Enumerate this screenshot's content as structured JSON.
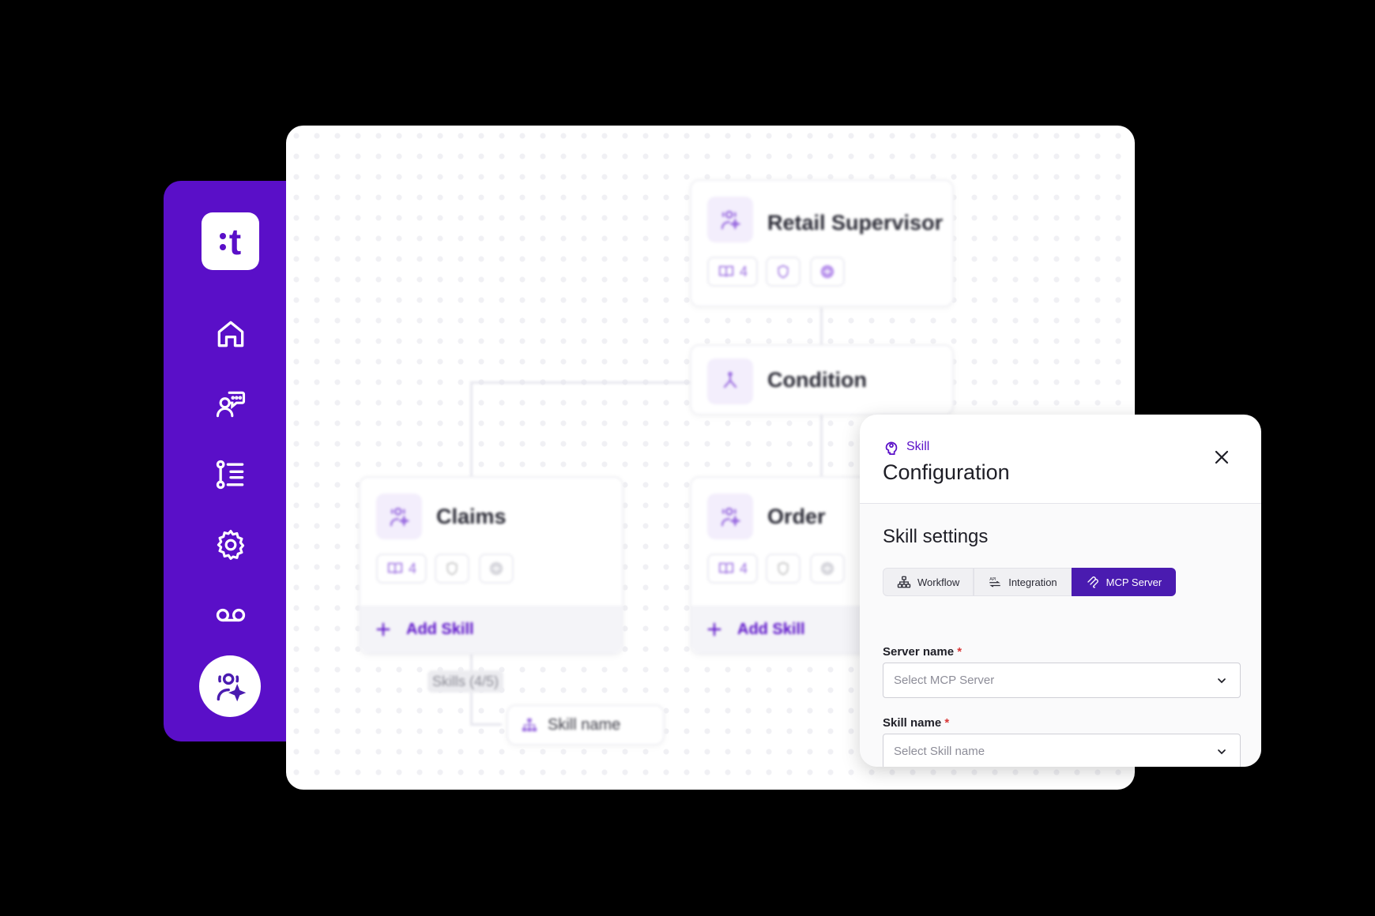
{
  "sidebar": {
    "logo_text": "t",
    "nav": [
      {
        "icon": "home-icon"
      },
      {
        "icon": "agent-chat-icon"
      },
      {
        "icon": "ordered-list-icon"
      },
      {
        "icon": "gear-icon"
      },
      {
        "icon": "voicemail-icon"
      },
      {
        "icon": "agent-sparkle-icon",
        "active": true
      }
    ]
  },
  "canvas": {
    "supervisor": {
      "title": "Retail Supervisor",
      "knowledge_count": "4"
    },
    "condition": {
      "title": "Condition"
    },
    "claims": {
      "title": "Claims",
      "knowledge_count": "4",
      "add_skill": "Add Skill"
    },
    "order": {
      "title": "Order",
      "knowledge_count": "4",
      "add_skill": "Add Skill"
    },
    "skills_badge": "Skills (4/5)",
    "skill_item": "Skill name"
  },
  "panel": {
    "eyebrow": "Skill",
    "title": "Configuration",
    "section_title": "Skill settings",
    "tabs": [
      {
        "label": "Workflow",
        "icon": "workflow-icon"
      },
      {
        "label": "Integration",
        "icon": "api-icon"
      },
      {
        "label": "MCP Server",
        "icon": "mcp-icon",
        "active": true
      }
    ],
    "server_name": {
      "label": "Server name",
      "required": "*",
      "placeholder": "Select MCP Server"
    },
    "skill_name": {
      "label": "Skill name",
      "required": "*",
      "placeholder": "Select Skill name"
    }
  },
  "colors": {
    "brand": "#5a0fc8",
    "tab_active": "#4a1bb0",
    "required": "#d93838"
  }
}
